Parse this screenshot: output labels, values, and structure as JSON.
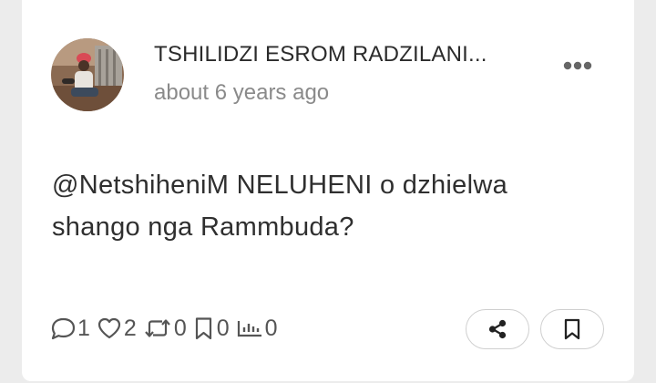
{
  "post": {
    "author": "TSHILIDZI ESROM RADZILANI...",
    "timestamp": "about 6 years ago",
    "text": "@NetshiheniM NELUHENI o dzhielwa shango nga Rammbuda?",
    "avatar_icon": "user-photo"
  },
  "stats": {
    "comments": "1",
    "likes": "2",
    "reposts": "0",
    "bookmarks": "0",
    "views": "0"
  },
  "actions": {
    "more_icon": "ellipsis-icon",
    "share_icon": "share-icon",
    "save_icon": "bookmark-icon"
  },
  "colors": {
    "card": "#ffffff",
    "background": "#ececec",
    "text": "#2f2f2f",
    "muted": "#8a8a8a",
    "icon": "#555555"
  }
}
